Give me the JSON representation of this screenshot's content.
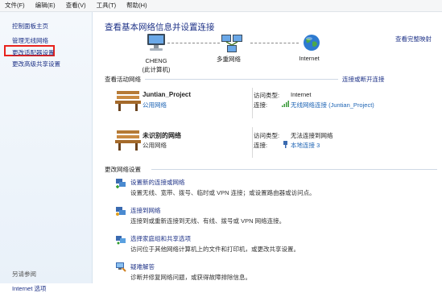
{
  "menubar": {
    "items": [
      "文件(F)",
      "编辑(E)",
      "查看(V)",
      "工具(T)",
      "帮助(H)"
    ]
  },
  "sidebar": {
    "links": [
      "控制面板主页",
      "管理无线网络",
      "更改适配器设置",
      "更改高级共享设置"
    ],
    "see_also": "另请参阅",
    "cut_link": "Internet 选项"
  },
  "main": {
    "title": "查看基本网络信息并设置连接",
    "full_map": "查看完整映射",
    "nodes": [
      {
        "name": "CHENG",
        "sub": "(此计算机)",
        "icon": "computer-icon"
      },
      {
        "name": "多重网络",
        "sub": "",
        "icon": "network-icon"
      },
      {
        "name": "Internet",
        "sub": "",
        "icon": "globe-icon"
      }
    ],
    "active_section": {
      "title": "查看活动网络",
      "connect_link": "连接或断开连接",
      "networks": [
        {
          "name": "Juntian_Project",
          "type": "公用网络",
          "access_label": "访问类型:",
          "access_value": "Internet",
          "conn_label": "连接:",
          "conn_value": "无线网络连接 (Juntian_Project)",
          "conn_icon": "wifi-signal-icon"
        },
        {
          "name": "未识别的网络",
          "type": "公用网络",
          "access_label": "访问类型:",
          "access_value": "无法连接到网络",
          "conn_label": "连接:",
          "conn_value": "本地连接 3",
          "conn_icon": "ethernet-icon"
        }
      ]
    },
    "change_section": {
      "title": "更改网络设置",
      "tasks": [
        {
          "link": "设置新的连接或网络",
          "desc": "设置无线、宽带、拨号、临时或 VPN 连接；或设置路由器或访问点。"
        },
        {
          "link": "连接到网络",
          "desc": "连接到或重新连接到无线、有线、拨号或 VPN 网络连接。"
        },
        {
          "link": "选择家庭组和共享选项",
          "desc": "访问位于其他网络计算机上的文件和打印机，或更改共享设置。"
        },
        {
          "link": "疑难解答",
          "desc": "诊断并修复网络问题，或获得故障排除信息。"
        }
      ]
    }
  },
  "colors": {
    "link": "#1e3287",
    "highlight": "#e8221c",
    "public_type": "#1e64b4"
  }
}
